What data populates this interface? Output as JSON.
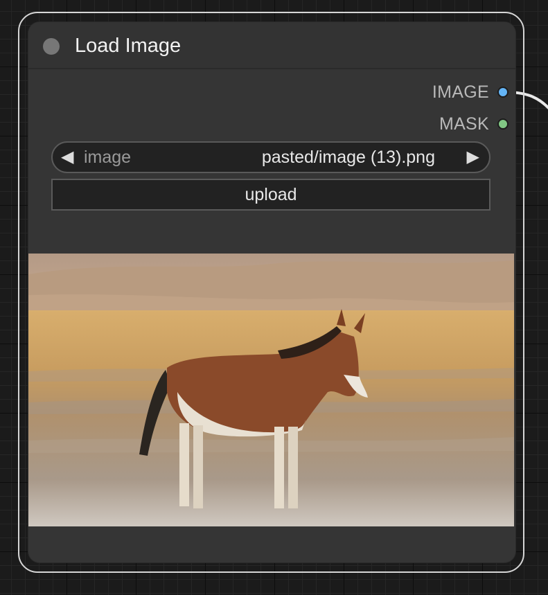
{
  "node": {
    "title": "Load Image",
    "outputs": [
      {
        "label": "IMAGE",
        "color": "#64b5f6"
      },
      {
        "label": "MASK",
        "color": "#81c784"
      }
    ],
    "widgets": {
      "image_combo": {
        "label": "image",
        "value": "pasted/image (13).png",
        "prev_arrow": "◀",
        "next_arrow": "▶"
      },
      "upload_label": "upload"
    },
    "preview": {
      "subject": "donkey-photo"
    }
  },
  "colors": {
    "canvas": "#1b1b1b",
    "node_body": "#353535",
    "selection_outline": "#d6d6d6",
    "link": "#ffffff"
  }
}
